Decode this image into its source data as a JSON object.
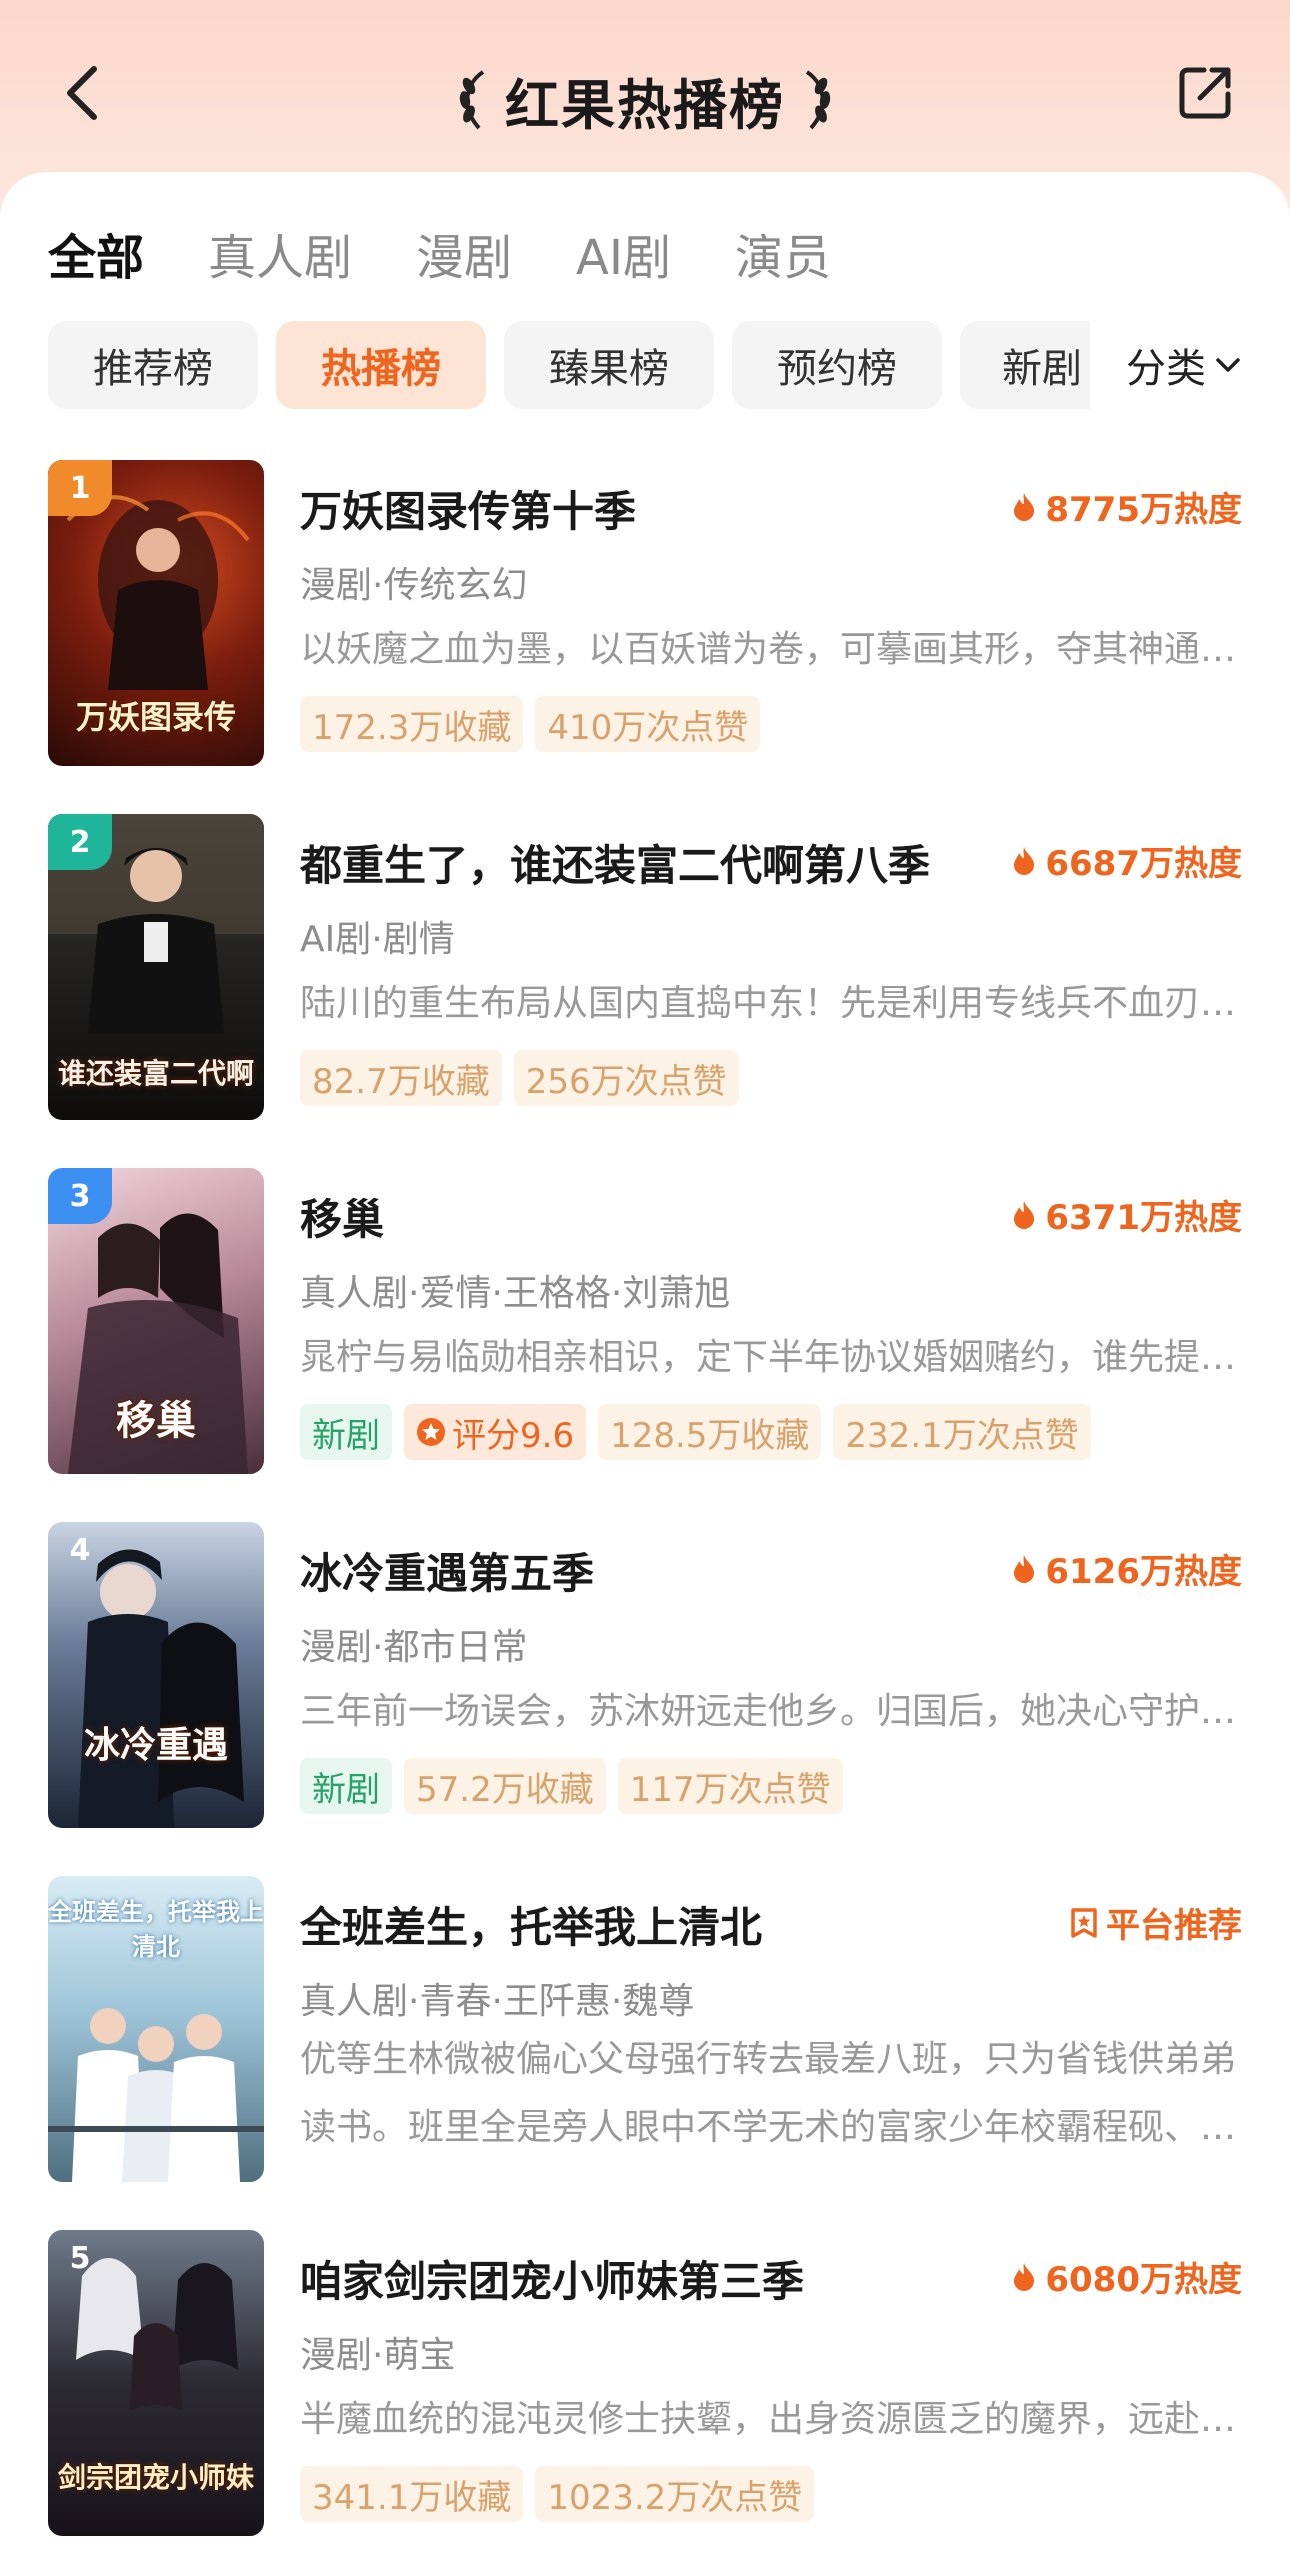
{
  "header": {
    "title": "红果热播榜"
  },
  "tabs": [
    "全部",
    "真人剧",
    "漫剧",
    "AI剧",
    "演员"
  ],
  "chips": [
    "推荐榜",
    "热播榜",
    "臻果榜",
    "预约榜",
    "新剧"
  ],
  "category": "分类",
  "items": [
    {
      "rank": "1",
      "name": "万妖图录传第十季",
      "heat": "8775万热度",
      "meta": "漫剧·传统玄幻",
      "desc": "以妖魔之血为墨，以百妖谱为卷，可摹画其形，夺其神通…",
      "tags": [
        "172.3万收藏",
        "410万次点赞"
      ],
      "cover_title": "万妖图录传"
    },
    {
      "rank": "2",
      "name": "都重生了，谁还装富二代啊第八季",
      "heat": "6687万热度",
      "meta": "AI剧·剧情",
      "desc": "陆川的重生布局从国内直捣中东！先是利用专线兵不血刃…",
      "tags": [
        "82.7万收藏",
        "256万次点赞"
      ],
      "cover_title": "谁还装富二代啊"
    },
    {
      "rank": "3",
      "name": "移巢",
      "heat": "6371万热度",
      "meta": "真人剧·爱情·王格格·刘萧旭",
      "desc": "晁柠与易临勋相亲相识，定下半年协议婚姻赌约，谁先提…",
      "new_tag": "新剧",
      "score": "评分9.6",
      "tags": [
        "128.5万收藏",
        "232.1万次点赞"
      ],
      "cover_title": "移巢"
    },
    {
      "rank": "4",
      "name": "冰冷重遇第五季",
      "heat": "6126万热度",
      "meta": "漫剧·都市日常",
      "desc": "三年前一场误会，苏沐妍远走他乡。归国后，她决心守护…",
      "new_tag": "新剧",
      "tags": [
        "57.2万收藏",
        "117万次点赞"
      ],
      "cover_title": "冰冷重遇"
    },
    {
      "name": "全班差生，托举我上清北",
      "badge": "平台推荐",
      "meta": "真人剧·青春·王阡惠·魏尊",
      "desc_lines": [
        "优等生林微被偏心父母强行转去最差八班，只为省钱供弟弟",
        "读书。班里全是旁人眼中不学无术的富家少年校霸程砚、…"
      ],
      "cover_title": "全班差生，托举我上清北"
    },
    {
      "rank": "5",
      "name": "咱家剑宗团宠小师妹第三季",
      "heat": "6080万热度",
      "meta": "漫剧·萌宝",
      "desc": "半魔血统的混沌灵修士扶颦，出身资源匮乏的魔界，远赴…",
      "tags": [
        "341.1万收藏",
        "1023.2万次点赞"
      ],
      "cover_title": "剑宗团宠小师妹"
    }
  ],
  "colors": {
    "accent": "#f0651d",
    "rank1": "#f08a2a",
    "rank2": "#1fb59a",
    "rank3": "#3b8ff0"
  }
}
